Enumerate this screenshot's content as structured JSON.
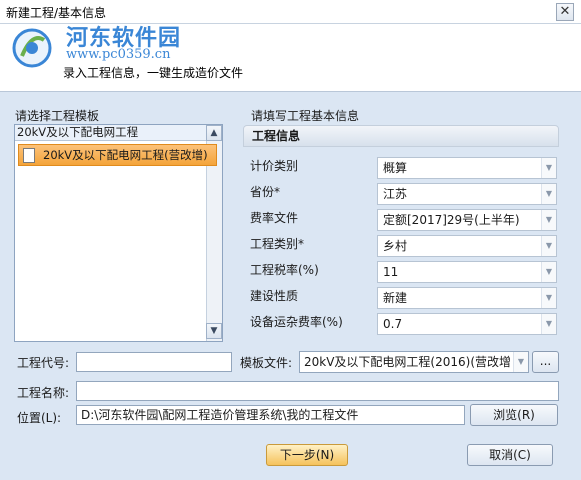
{
  "window": {
    "title": "新建工程/基本信息",
    "close_glyph": "✕"
  },
  "watermark": {
    "name": "河东软件园",
    "url": "www.pc0359.cn"
  },
  "header": {
    "subtitle": "录入工程信息，一键生成造价文件"
  },
  "template_panel": {
    "label": "请选择工程模板",
    "header_item": "20kV及以下配电网工程",
    "selected_item": "20kV及以下配电网工程(营改增)",
    "scroll_up": "▲",
    "scroll_down": "▼"
  },
  "info_panel": {
    "label": "请填写工程基本信息",
    "section_title": "工程信息",
    "fields": [
      {
        "label": "计价类别",
        "value": "概算",
        "arrow": "▼"
      },
      {
        "label": "省份*",
        "value": "江苏",
        "arrow": "▼"
      },
      {
        "label": "费率文件",
        "value": "定额[2017]29号(上半年)",
        "arrow": "▼"
      },
      {
        "label": "工程类别*",
        "value": "乡村",
        "arrow": "▼"
      },
      {
        "label": "工程税率(%)",
        "value": "11",
        "arrow": "▼"
      },
      {
        "label": "建设性质",
        "value": "新建",
        "arrow": "▼"
      },
      {
        "label": "设备运杂费率(%)",
        "value": "0.7",
        "arrow": "▼"
      }
    ]
  },
  "form": {
    "project_code_label": "工程代号:",
    "project_code_value": "",
    "template_file_label": "模板文件:",
    "template_file_value": "20kV及以下配电网工程(2016)(营改增",
    "template_file_arrow": "▼",
    "template_browse": "...",
    "project_name_label": "工程名称:",
    "project_name_value": "",
    "location_label": "位置(L):",
    "location_value": "D:\\河东软件园\\配网工程造价管理系统\\我的工程文件",
    "browse_button": "浏览(R)"
  },
  "buttons": {
    "next": "下一步(N)",
    "cancel": "取消(C)"
  },
  "colors": {
    "accent": "#f4a43a",
    "window_bg": "#dbe6f3",
    "watermark": "#3a86d6"
  }
}
